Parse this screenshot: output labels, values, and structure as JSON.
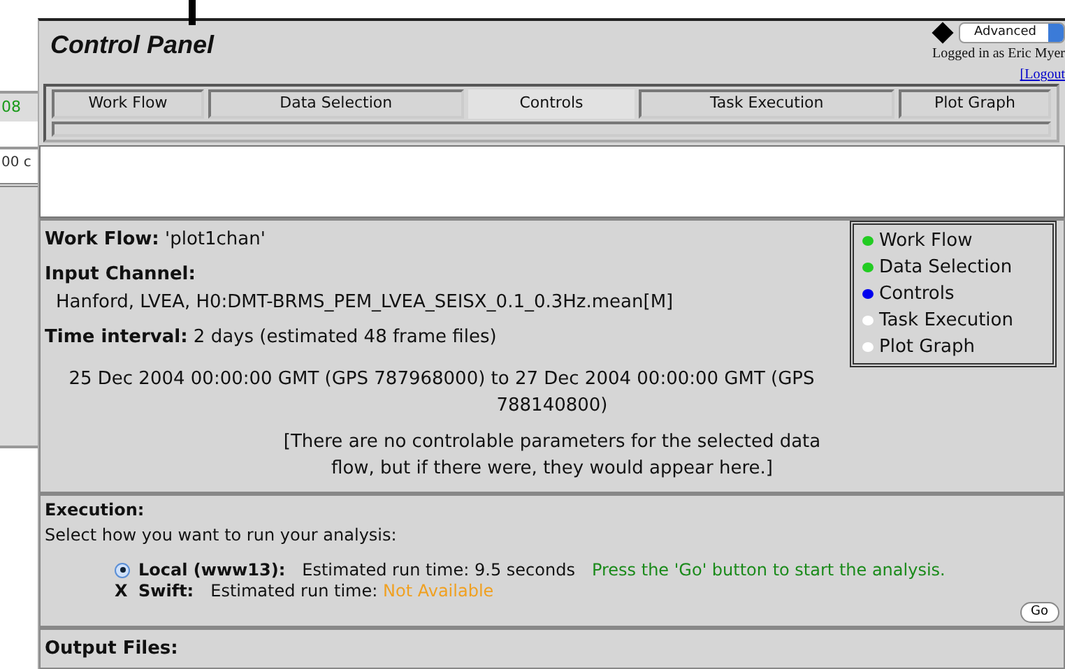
{
  "background_window": {
    "cells": [
      "08",
      "00 c"
    ]
  },
  "window": {
    "title": "Control Panel"
  },
  "mode_select": {
    "value": "Advanced"
  },
  "login": {
    "text": "Logged in as Eric Myer",
    "logout": "[Logout"
  },
  "tabs": [
    {
      "label": "Work Flow",
      "selected": false
    },
    {
      "label": "Data Selection",
      "selected": false
    },
    {
      "label": "Controls",
      "selected": true
    },
    {
      "label": "Task Execution",
      "selected": false
    },
    {
      "label": "Plot Graph",
      "selected": false
    }
  ],
  "summary": {
    "work_flow_label": "Work Flow:",
    "work_flow": "'plot1chan'",
    "input_channel_label": "Input Channel:",
    "input_channel": "Hanford, LVEA, H0:DMT-BRMS_PEM_LVEA_SEISX_0.1_0.3Hz.mean[M]",
    "time_label": "Time interval:",
    "time": "2 days (estimated 48 frame files)",
    "range": "25 Dec 2004 00:00:00 GMT (GPS 787968000) to 27 Dec 2004 00:00:00 GMT (GPS 788140800)",
    "note": "[There are no controlable parameters for the selected data flow, but if there were, they would appear here.]"
  },
  "progress": [
    {
      "label": "Work Flow",
      "color": "#22cc22"
    },
    {
      "label": "Data Selection",
      "color": "#22cc22"
    },
    {
      "label": "Controls",
      "color": "#0000ee"
    },
    {
      "label": "Task Execution",
      "color": "#ffffff"
    },
    {
      "label": "Plot Graph",
      "color": "#ffffff"
    }
  ],
  "execution": {
    "title": "Execution:",
    "prompt": "Select how you want to run your analysis:",
    "options": [
      {
        "kind": "radio",
        "selected": true,
        "name": "Local (www13):",
        "estimate_label": "Estimated run time:",
        "estimate": "9.5 seconds",
        "available": true
      },
      {
        "kind": "unavailable",
        "marker": "X",
        "name": "Swift:",
        "estimate_label": "Estimated run time:",
        "estimate": "Not Available",
        "available": false
      }
    ],
    "hint": "Press the 'Go' button to start the analysis.",
    "go": "Go"
  },
  "output": {
    "title": "Output Files:"
  }
}
